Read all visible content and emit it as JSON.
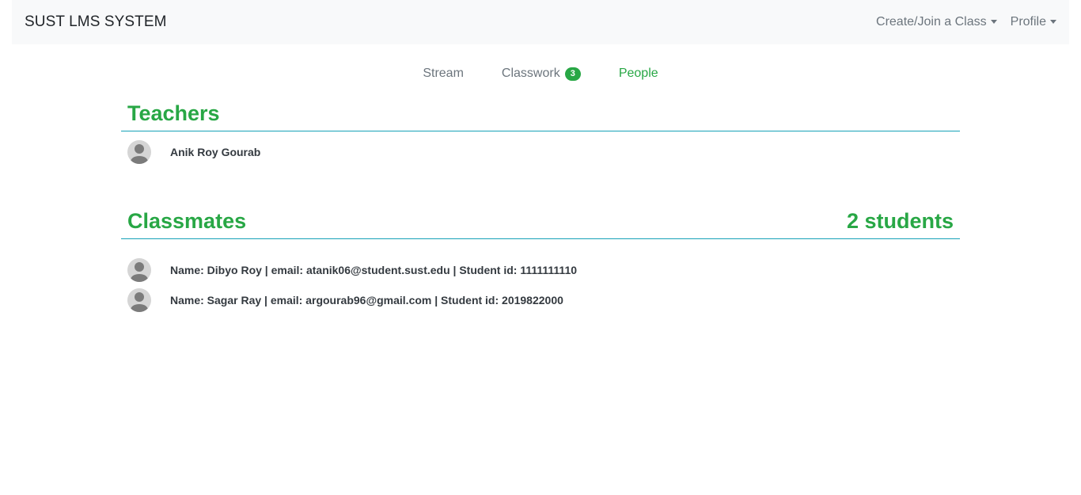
{
  "navbar": {
    "brand": "SUST LMS SYSTEM",
    "create_join": "Create/Join a Class",
    "profile": "Profile"
  },
  "tabs": {
    "stream": "Stream",
    "classwork": "Classwork",
    "classwork_badge": "3",
    "people": "People",
    "active": "People"
  },
  "teachers": {
    "title": "Teachers",
    "items": [
      {
        "name": "Anik Roy Gourab"
      }
    ]
  },
  "classmates": {
    "title": "Classmates",
    "count_label": "2 students",
    "items": [
      {
        "text": "Name: Dibyo Roy | email: atanik06@student.sust.edu | Student id: 1111111110"
      },
      {
        "text": "Name: Sagar Ray | email: argourab96@gmail.com | Student id: 2019822000"
      }
    ]
  },
  "colors": {
    "accent": "#28a745",
    "divider": "#17a2b8",
    "navbar_bg": "#f8f9fa",
    "muted": "#6c757d"
  }
}
